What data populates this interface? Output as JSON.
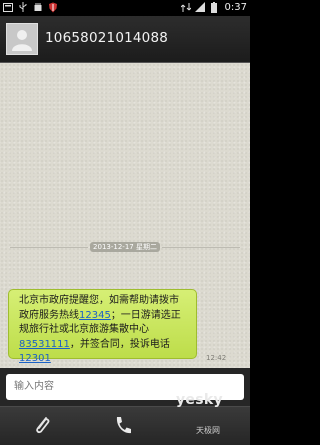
{
  "status_bar": {
    "time": "0:37",
    "icons": [
      "notification-icon",
      "usb-icon",
      "android-debug-icon",
      "shield-icon",
      "network-icon",
      "signal-icon",
      "battery-icon"
    ]
  },
  "header": {
    "contact": "10658021014088",
    "avatar": "person-icon"
  },
  "conversation": {
    "date_divider": "2013-12-17 星期二",
    "messages": [
      {
        "parts": [
          {
            "text": "北京市政府提醒您，如需帮助请拨市政府服务热线",
            "link": false
          },
          {
            "text": "12345",
            "link": true
          },
          {
            "text": "；一日游请选正规旅行社或北京旅游集散中心",
            "link": false
          },
          {
            "text": "83531111",
            "link": true
          },
          {
            "text": "，并签合同，投诉电话",
            "link": false
          },
          {
            "text": "12301",
            "link": true
          }
        ],
        "time": "12:42"
      }
    ]
  },
  "compose": {
    "placeholder": "输入内容",
    "attach_icon": "paperclip-icon",
    "call_icon": "phone-icon"
  },
  "watermark": {
    "brand": "yesky",
    "sub": "天极网"
  },
  "colors": {
    "bubble": "#c9e65a",
    "link": "#1a61c6",
    "conversation_bg": "#dcdad0"
  }
}
